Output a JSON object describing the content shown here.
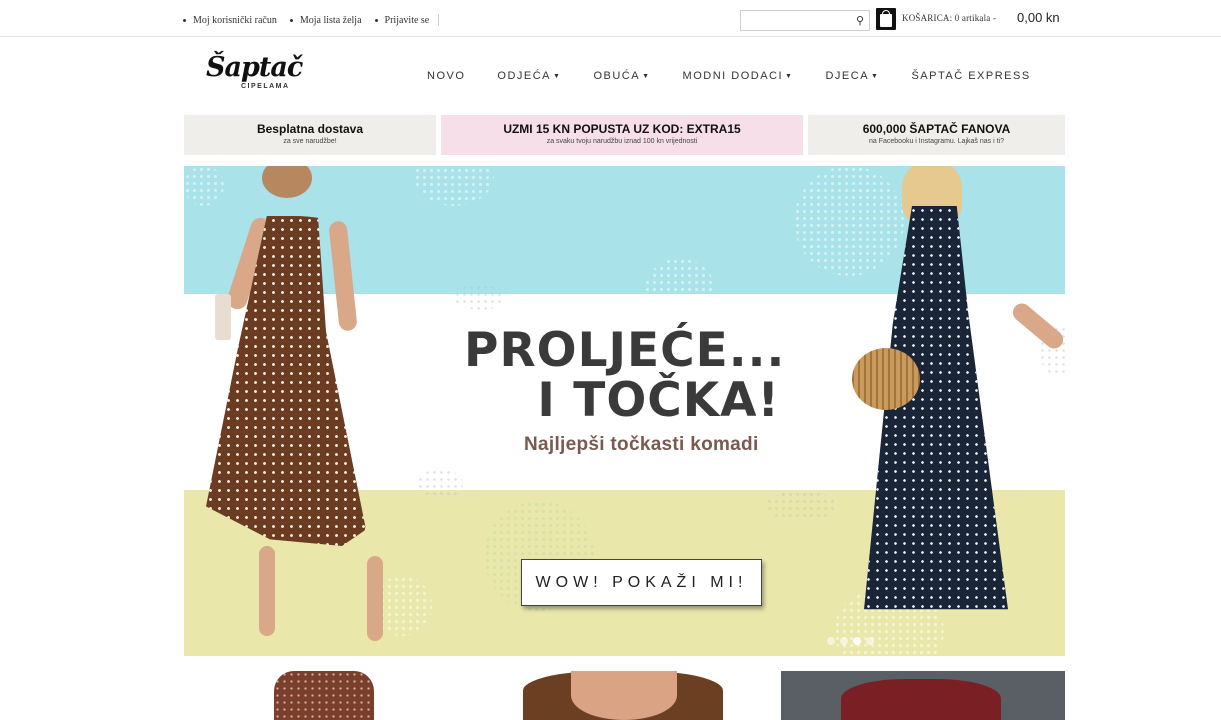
{
  "topbar": {
    "links": [
      "Moj korisnički račun",
      "Moja lista želja",
      "Prijavite se"
    ],
    "search": {
      "placeholder": ""
    },
    "cart_label": "KOŠARICA: 0 artikala -",
    "cart_total": "0,00 kn"
  },
  "header": {
    "logo_text": "Šaptač",
    "logo_sub": "CIPELAMA",
    "nav": [
      "NOVO",
      "ODJEĆA",
      "OBUĆA",
      "MODNI DODACI",
      "DJECA",
      "ŠAPTAČ EXPRESS"
    ]
  },
  "promos": [
    {
      "title": "Besplatna dostava",
      "subtitle": "za sve narudžbe!",
      "color": "#efeeea"
    },
    {
      "title": "UZMI 15 KN POPUSTA UZ KOD: EXTRA15",
      "subtitle": "za svaku tvoju narudžbu iznad 100 kn vrijednosti",
      "color": "#f6dfe8"
    },
    {
      "title": "600,000 ŠAPTAČ FANOVA",
      "subtitle": "na Facebooku i Instagramu. Lajkaš nas i ti?",
      "color": "#efeeea"
    }
  ],
  "hero": {
    "line1": "PROLJEĆE...",
    "line2": "I TOČKA!",
    "subtitle": "Najljepši točkasti komadi",
    "cta": "WOW! POKAŽI MI!",
    "colors": {
      "top_band": "#a9e2e9",
      "bottom_band": "#e9e7a9",
      "headline": "#3a3a3a",
      "subtitle": "#7a5a4f"
    }
  }
}
